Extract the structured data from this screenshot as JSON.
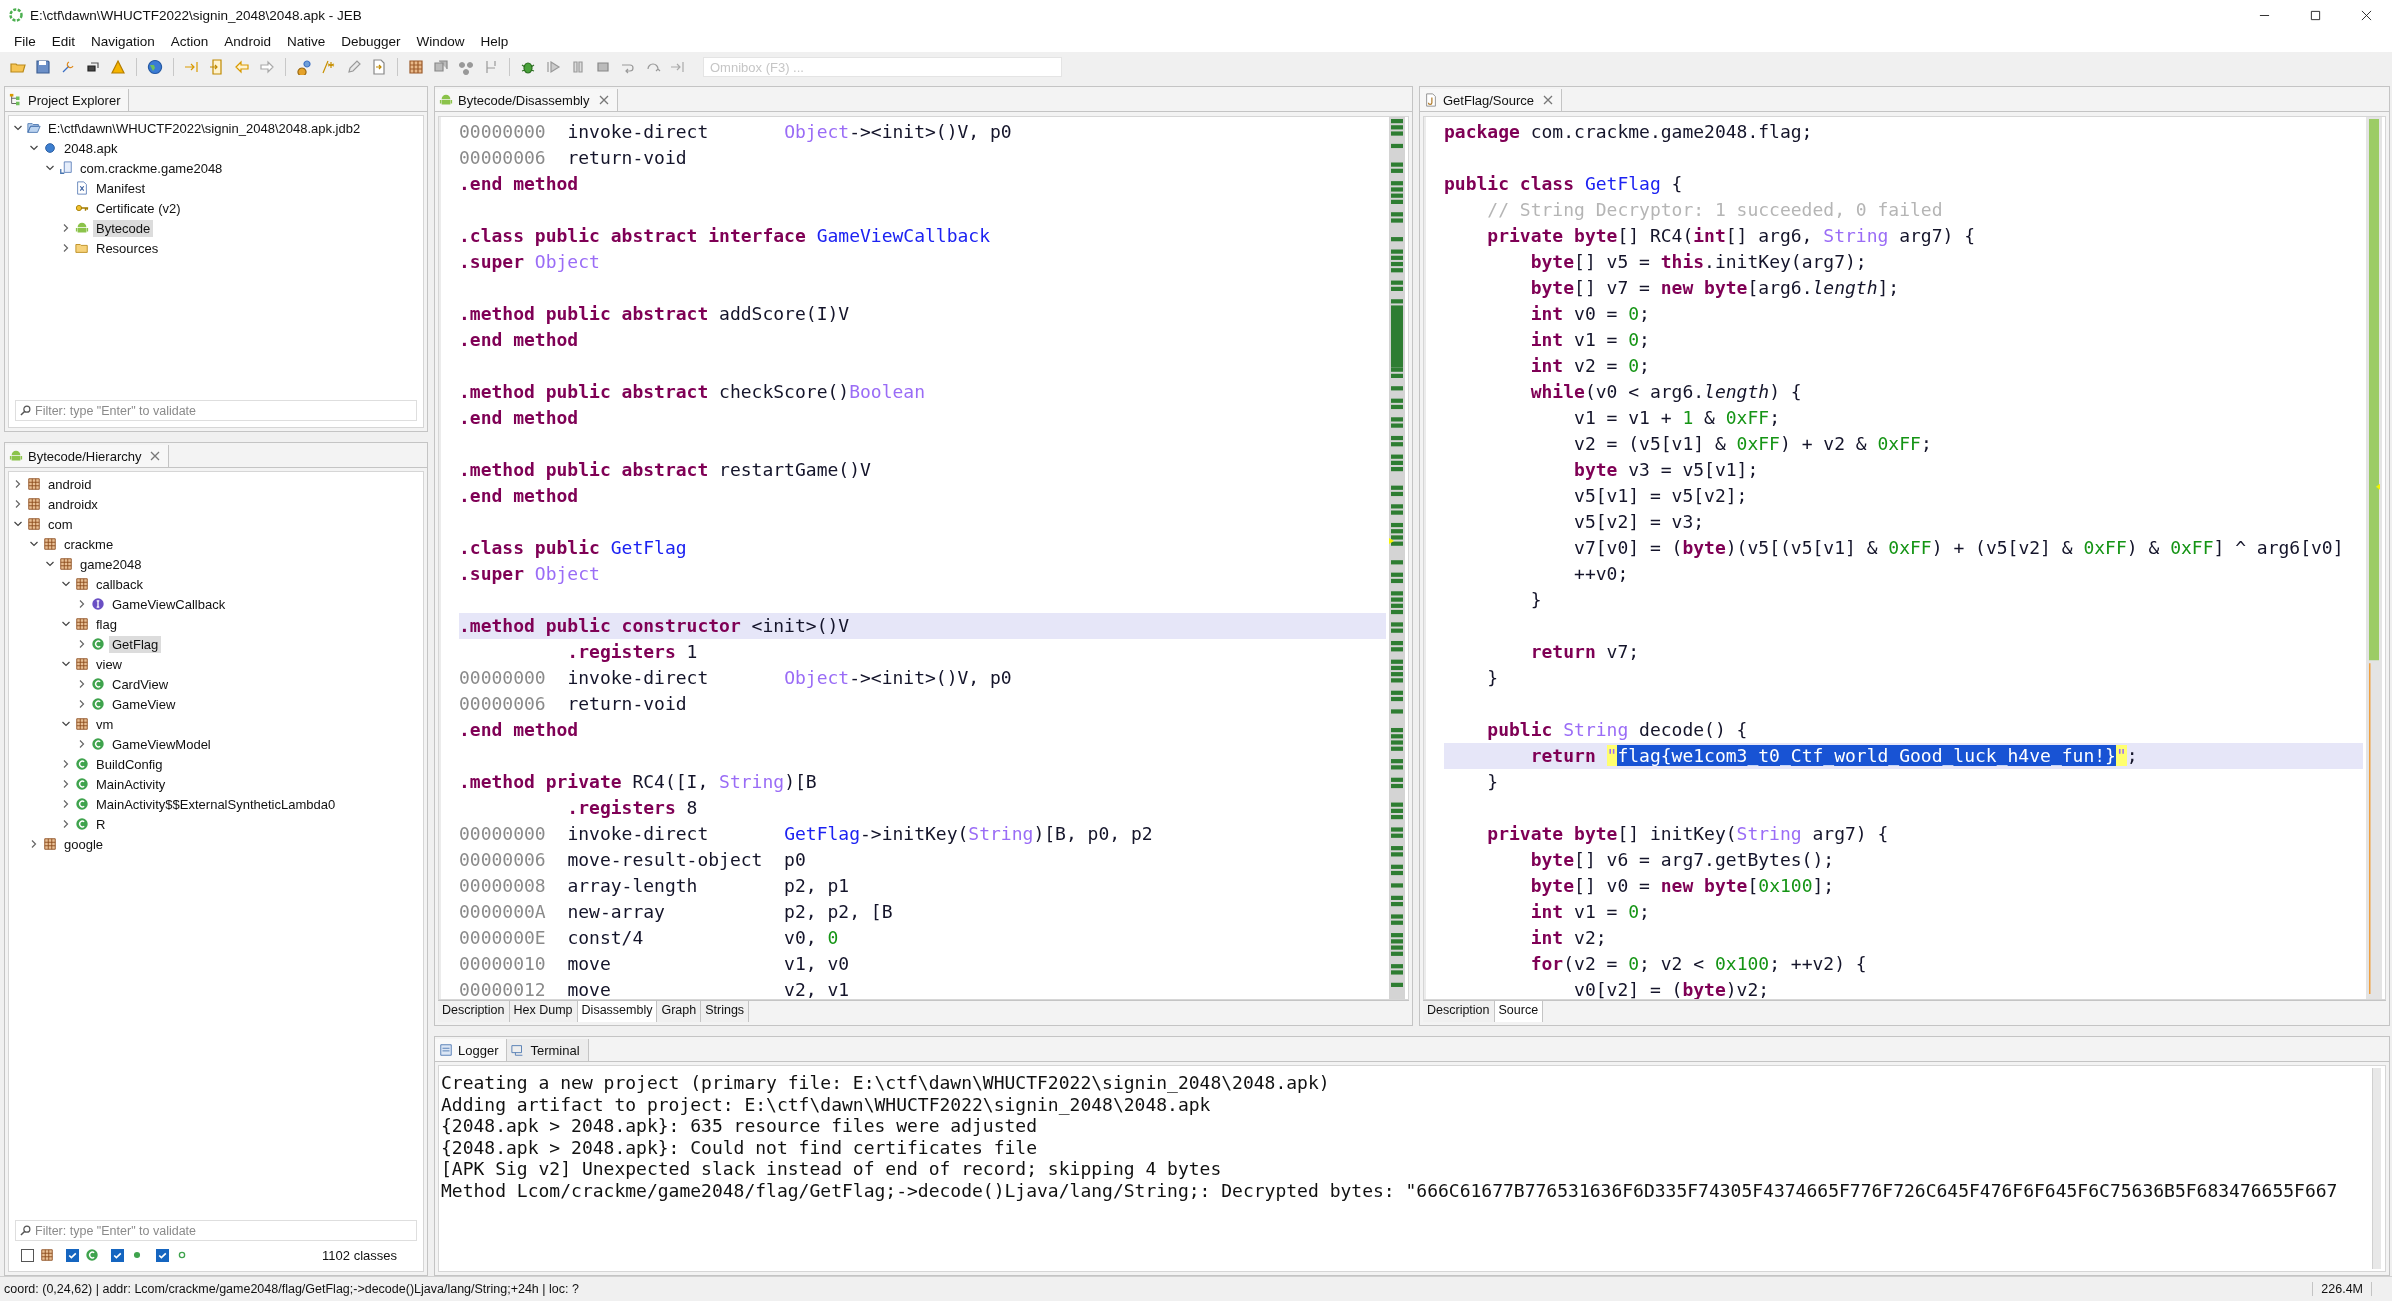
{
  "window": {
    "title": "E:\\ctf\\dawn\\WHUCTF2022\\signin_2048\\2048.apk - JEB"
  },
  "menu": [
    "File",
    "Edit",
    "Navigation",
    "Action",
    "Android",
    "Native",
    "Debugger",
    "Window",
    "Help"
  ],
  "omnibox": {
    "placeholder": "Omnibox (F3) ..."
  },
  "project_explorer": {
    "tab": "Project Explorer",
    "filter_placeholder": "Filter: type \"Enter\" to validate",
    "tree": [
      {
        "label": "E:\\ctf\\dawn\\WHUCTF2022\\signin_2048\\2048.apk.jdb2",
        "kind": "project",
        "expanded": true,
        "selected": false,
        "children": [
          {
            "label": "2048.apk",
            "kind": "apk",
            "expanded": true,
            "selected": false,
            "children": [
              {
                "label": "com.crackme.game2048",
                "kind": "app",
                "expanded": true,
                "selected": false,
                "children": [
                  {
                    "label": "Manifest",
                    "kind": "manifest",
                    "selected": false
                  },
                  {
                    "label": "Certificate (v2)",
                    "kind": "certificate",
                    "selected": false
                  },
                  {
                    "label": "Bytecode",
                    "kind": "android",
                    "expanded": false,
                    "selected": true
                  },
                  {
                    "label": "Resources",
                    "kind": "folder",
                    "expanded": false,
                    "selected": false
                  }
                ]
              }
            ]
          }
        ]
      }
    ]
  },
  "hierarchy": {
    "tab": "Bytecode/Hierarchy",
    "filter_placeholder": "Filter: type \"Enter\" to validate",
    "tree": [
      {
        "label": "android",
        "kind": "package",
        "expanded": false,
        "selected": false
      },
      {
        "label": "androidx",
        "kind": "package",
        "expanded": false,
        "selected": false
      },
      {
        "label": "com",
        "kind": "package",
        "expanded": true,
        "selected": false,
        "children": [
          {
            "label": "crackme",
            "kind": "package",
            "expanded": true,
            "selected": false,
            "children": [
              {
                "label": "game2048",
                "kind": "package",
                "expanded": true,
                "selected": false,
                "children": [
                  {
                    "label": "callback",
                    "kind": "package",
                    "expanded": true,
                    "selected": false,
                    "children": [
                      {
                        "label": "GameViewCallback",
                        "kind": "interface",
                        "expanded": false,
                        "selected": false
                      }
                    ]
                  },
                  {
                    "label": "flag",
                    "kind": "package",
                    "expanded": true,
                    "selected": false,
                    "children": [
                      {
                        "label": "GetFlag",
                        "kind": "class",
                        "expanded": false,
                        "selected": true
                      }
                    ]
                  },
                  {
                    "label": "view",
                    "kind": "package",
                    "expanded": true,
                    "selected": false,
                    "children": [
                      {
                        "label": "CardView",
                        "kind": "class",
                        "expanded": false,
                        "selected": false
                      },
                      {
                        "label": "GameView",
                        "kind": "class",
                        "expanded": false,
                        "selected": false
                      }
                    ]
                  },
                  {
                    "label": "vm",
                    "kind": "package",
                    "expanded": true,
                    "selected": false,
                    "children": [
                      {
                        "label": "GameViewModel",
                        "kind": "class",
                        "expanded": false,
                        "selected": false
                      }
                    ]
                  },
                  {
                    "label": "BuildConfig",
                    "kind": "class",
                    "expanded": false,
                    "selected": false
                  },
                  {
                    "label": "MainActivity",
                    "kind": "class",
                    "expanded": false,
                    "selected": false
                  },
                  {
                    "label": "MainActivity$$ExternalSyntheticLambda0",
                    "kind": "class",
                    "expanded": false,
                    "selected": false
                  },
                  {
                    "label": "R",
                    "kind": "class",
                    "expanded": false,
                    "selected": false
                  }
                ]
              }
            ]
          },
          {
            "label": "google",
            "kind": "package",
            "expanded": false,
            "selected": false
          }
        ]
      }
    ],
    "filters": [
      {
        "kind": "package",
        "checked": false
      },
      {
        "kind": "class",
        "checked": true
      },
      {
        "kind": "method",
        "checked": true
      },
      {
        "kind": "field",
        "checked": true
      }
    ],
    "count": "1102 classes"
  },
  "disassembly": {
    "tab": "Bytecode/Disassembly",
    "bottom_tabs": [
      {
        "label": "Description",
        "selected": false
      },
      {
        "label": "Hex Dump",
        "selected": false
      },
      {
        "label": "Disassembly",
        "selected": true
      },
      {
        "label": "Graph",
        "selected": false
      },
      {
        "label": "Strings",
        "selected": false
      }
    ],
    "lines": [
      {
        "current": false,
        "segments": [
          {
            "kind": "address",
            "text": "00000000"
          },
          {
            "kind": "plain",
            "text": "  invoke-direct       "
          },
          {
            "kind": "type",
            "text": "Object"
          },
          {
            "kind": "plain",
            "text": "-><init>()V, p0"
          }
        ]
      },
      {
        "current": false,
        "segments": [
          {
            "kind": "address",
            "text": "00000006"
          },
          {
            "kind": "plain",
            "text": "  return-void"
          }
        ]
      },
      {
        "current": false,
        "segments": [
          {
            "kind": "keyword",
            "text": ".end method"
          }
        ]
      },
      {
        "current": false
      },
      {
        "current": false,
        "segments": [
          {
            "kind": "keyword",
            "text": ".class public abstract interface "
          },
          {
            "kind": "class",
            "text": "GameViewCallback"
          }
        ]
      },
      {
        "current": false,
        "segments": [
          {
            "kind": "keyword",
            "text": ".super "
          },
          {
            "kind": "type",
            "text": "Object"
          }
        ]
      },
      {
        "current": false
      },
      {
        "current": false,
        "segments": [
          {
            "kind": "keyword",
            "text": ".method public abstract "
          },
          {
            "kind": "plain",
            "text": "addScore(I)V"
          }
        ]
      },
      {
        "current": false,
        "segments": [
          {
            "kind": "keyword",
            "text": ".end method"
          }
        ]
      },
      {
        "current": false
      },
      {
        "current": false,
        "segments": [
          {
            "kind": "keyword",
            "text": ".method public abstract "
          },
          {
            "kind": "plain",
            "text": "checkScore()"
          },
          {
            "kind": "type",
            "text": "Boolean"
          }
        ]
      },
      {
        "current": false,
        "segments": [
          {
            "kind": "keyword",
            "text": ".end method"
          }
        ]
      },
      {
        "current": false
      },
      {
        "current": false,
        "segments": [
          {
            "kind": "keyword",
            "text": ".method public abstract "
          },
          {
            "kind": "plain",
            "text": "restartGame()V"
          }
        ]
      },
      {
        "current": false,
        "segments": [
          {
            "kind": "keyword",
            "text": ".end method"
          }
        ]
      },
      {
        "current": false
      },
      {
        "current": false,
        "segments": [
          {
            "kind": "keyword",
            "text": ".class public "
          },
          {
            "kind": "class",
            "text": "GetFlag"
          }
        ]
      },
      {
        "current": false,
        "segments": [
          {
            "kind": "keyword",
            "text": ".super "
          },
          {
            "kind": "type",
            "text": "Object"
          }
        ]
      },
      {
        "current": false
      },
      {
        "current": true,
        "segments": [
          {
            "kind": "keyword",
            "text": ".method public constructor "
          },
          {
            "kind": "plain",
            "text": "<init>()V"
          }
        ]
      },
      {
        "current": false,
        "segments": [
          {
            "kind": "keyword",
            "text": "          .registers"
          },
          {
            "kind": "plain",
            "text": " 1"
          }
        ]
      },
      {
        "current": false,
        "segments": [
          {
            "kind": "address",
            "text": "00000000"
          },
          {
            "kind": "plain",
            "text": "  invoke-direct       "
          },
          {
            "kind": "type",
            "text": "Object"
          },
          {
            "kind": "plain",
            "text": "-><init>()V, p0"
          }
        ]
      },
      {
        "current": false,
        "segments": [
          {
            "kind": "address",
            "text": "00000006"
          },
          {
            "kind": "plain",
            "text": "  return-void"
          }
        ]
      },
      {
        "current": false,
        "segments": [
          {
            "kind": "keyword",
            "text": ".end method"
          }
        ]
      },
      {
        "current": false
      },
      {
        "current": false,
        "segments": [
          {
            "kind": "keyword",
            "text": ".method private "
          },
          {
            "kind": "plain",
            "text": "RC4([I, "
          },
          {
            "kind": "type",
            "text": "String"
          },
          {
            "kind": "plain",
            "text": ")[B"
          }
        ]
      },
      {
        "current": false,
        "segments": [
          {
            "kind": "keyword",
            "text": "          .registers"
          },
          {
            "kind": "plain",
            "text": " 8"
          }
        ]
      },
      {
        "current": false,
        "segments": [
          {
            "kind": "address",
            "text": "00000000"
          },
          {
            "kind": "plain",
            "text": "  invoke-direct       "
          },
          {
            "kind": "class",
            "text": "GetFlag"
          },
          {
            "kind": "plain",
            "text": "->initKey("
          },
          {
            "kind": "type",
            "text": "String"
          },
          {
            "kind": "plain",
            "text": ")[B, p0, p2"
          }
        ]
      },
      {
        "current": false,
        "segments": [
          {
            "kind": "address",
            "text": "00000006"
          },
          {
            "kind": "plain",
            "text": "  move-result-object  p0"
          }
        ]
      },
      {
        "current": false,
        "segments": [
          {
            "kind": "address",
            "text": "00000008"
          },
          {
            "kind": "plain",
            "text": "  array-length        p2, p1"
          }
        ]
      },
      {
        "current": false,
        "segments": [
          {
            "kind": "address",
            "text": "0000000A"
          },
          {
            "kind": "plain",
            "text": "  new-array           p2, p2, [B"
          }
        ]
      },
      {
        "current": false,
        "segments": [
          {
            "kind": "address",
            "text": "0000000E"
          },
          {
            "kind": "plain",
            "text": "  const/4             v0, "
          },
          {
            "kind": "number",
            "text": "0"
          }
        ]
      },
      {
        "current": false,
        "segments": [
          {
            "kind": "address",
            "text": "00000010"
          },
          {
            "kind": "plain",
            "text": "  move                v1, v0"
          }
        ]
      },
      {
        "current": false,
        "segments": [
          {
            "kind": "address",
            "text": "00000012"
          },
          {
            "kind": "plain",
            "text": "  move                v2, v1"
          }
        ]
      }
    ]
  },
  "source": {
    "tab": "GetFlag/Source",
    "bottom_tabs": [
      {
        "label": "Description",
        "selected": false
      },
      {
        "label": "Source",
        "selected": true
      }
    ],
    "lines": [
      {
        "current": false,
        "segments": [
          {
            "kind": "keyword",
            "text": "package"
          },
          {
            "kind": "plain",
            "text": " com.crackme.game2048.flag;"
          }
        ]
      },
      {
        "current": false
      },
      {
        "current": false,
        "segments": [
          {
            "kind": "keyword",
            "text": "public class "
          },
          {
            "kind": "class",
            "text": "GetFlag"
          },
          {
            "kind": "plain",
            "text": " {"
          }
        ]
      },
      {
        "current": false,
        "segments": [
          {
            "kind": "comment",
            "text": "    // String Decryptor: 1 succeeded, 0 failed"
          }
        ]
      },
      {
        "current": false,
        "segments": [
          {
            "kind": "keyword",
            "text": "    private byte"
          },
          {
            "kind": "plain",
            "text": "[] RC4("
          },
          {
            "kind": "keyword",
            "text": "int"
          },
          {
            "kind": "plain",
            "text": "[] arg6, "
          },
          {
            "kind": "type",
            "text": "String"
          },
          {
            "kind": "plain",
            "text": " arg7) {"
          }
        ]
      },
      {
        "current": false,
        "segments": [
          {
            "kind": "keyword",
            "text": "        byte"
          },
          {
            "kind": "plain",
            "text": "[] v5 = "
          },
          {
            "kind": "keyword",
            "text": "this"
          },
          {
            "kind": "plain",
            "text": ".initKey(arg7);"
          }
        ]
      },
      {
        "current": false,
        "segments": [
          {
            "kind": "keyword",
            "text": "        byte"
          },
          {
            "kind": "plain",
            "text": "[] v7 = "
          },
          {
            "kind": "keyword",
            "text": "new byte"
          },
          {
            "kind": "plain",
            "text": "[arg6."
          },
          {
            "kind": "italic",
            "text": "length"
          },
          {
            "kind": "plain",
            "text": "];"
          }
        ]
      },
      {
        "current": false,
        "segments": [
          {
            "kind": "keyword",
            "text": "        int"
          },
          {
            "kind": "plain",
            "text": " v0 = "
          },
          {
            "kind": "number",
            "text": "0"
          },
          {
            "kind": "plain",
            "text": ";"
          }
        ]
      },
      {
        "current": false,
        "segments": [
          {
            "kind": "keyword",
            "text": "        int"
          },
          {
            "kind": "plain",
            "text": " v1 = "
          },
          {
            "kind": "number",
            "text": "0"
          },
          {
            "kind": "plain",
            "text": ";"
          }
        ]
      },
      {
        "current": false,
        "segments": [
          {
            "kind": "keyword",
            "text": "        int"
          },
          {
            "kind": "plain",
            "text": " v2 = "
          },
          {
            "kind": "number",
            "text": "0"
          },
          {
            "kind": "plain",
            "text": ";"
          }
        ]
      },
      {
        "current": false,
        "segments": [
          {
            "kind": "keyword",
            "text": "        while"
          },
          {
            "kind": "plain",
            "text": "(v0 < arg6."
          },
          {
            "kind": "italic",
            "text": "length"
          },
          {
            "kind": "plain",
            "text": ") {"
          }
        ]
      },
      {
        "current": false,
        "segments": [
          {
            "kind": "plain",
            "text": "            v1 = v1 + "
          },
          {
            "kind": "number",
            "text": "1"
          },
          {
            "kind": "plain",
            "text": " & "
          },
          {
            "kind": "number",
            "text": "0xFF"
          },
          {
            "kind": "plain",
            "text": ";"
          }
        ]
      },
      {
        "current": false,
        "segments": [
          {
            "kind": "plain",
            "text": "            v2 = (v5[v1] & "
          },
          {
            "kind": "number",
            "text": "0xFF"
          },
          {
            "kind": "plain",
            "text": ") + v2 & "
          },
          {
            "kind": "number",
            "text": "0xFF"
          },
          {
            "kind": "plain",
            "text": ";"
          }
        ]
      },
      {
        "current": false,
        "segments": [
          {
            "kind": "keyword",
            "text": "            byte"
          },
          {
            "kind": "plain",
            "text": " v3 = v5[v1];"
          }
        ]
      },
      {
        "current": false,
        "segments": [
          {
            "kind": "plain",
            "text": "            v5[v1] = v5[v2];"
          }
        ]
      },
      {
        "current": false,
        "segments": [
          {
            "kind": "plain",
            "text": "            v5[v2] = v3;"
          }
        ]
      },
      {
        "current": false,
        "segments": [
          {
            "kind": "plain",
            "text": "            v7[v0] = ("
          },
          {
            "kind": "keyword",
            "text": "byte"
          },
          {
            "kind": "plain",
            "text": ")(v5[(v5[v1] & "
          },
          {
            "kind": "number",
            "text": "0xFF"
          },
          {
            "kind": "plain",
            "text": ") + (v5[v2] & "
          },
          {
            "kind": "number",
            "text": "0xFF"
          },
          {
            "kind": "plain",
            "text": ") & "
          },
          {
            "kind": "number",
            "text": "0xFF"
          },
          {
            "kind": "plain",
            "text": "] ^ arg6[v0]"
          }
        ]
      },
      {
        "current": false,
        "segments": [
          {
            "kind": "plain",
            "text": "            ++v0;"
          }
        ]
      },
      {
        "current": false,
        "segments": [
          {
            "kind": "plain",
            "text": "        }"
          }
        ]
      },
      {
        "current": false
      },
      {
        "current": false,
        "segments": [
          {
            "kind": "keyword",
            "text": "        return"
          },
          {
            "kind": "plain",
            "text": " v7;"
          }
        ]
      },
      {
        "current": false,
        "segments": [
          {
            "kind": "plain",
            "text": "    }"
          }
        ]
      },
      {
        "current": false
      },
      {
        "current": false,
        "segments": [
          {
            "kind": "keyword",
            "text": "    public "
          },
          {
            "kind": "type",
            "text": "String"
          },
          {
            "kind": "plain",
            "text": " decode() {"
          }
        ]
      },
      {
        "current": true,
        "segments": [
          {
            "kind": "keyword",
            "text": "        return "
          },
          {
            "kind": "match",
            "text": "\""
          },
          {
            "kind": "selection",
            "text": "flag{we1com3_t0_Ctf_world_Good_luck_h4ve_fun!}"
          },
          {
            "kind": "match",
            "text": "\""
          },
          {
            "kind": "plain",
            "text": ";"
          }
        ]
      },
      {
        "current": false,
        "segments": [
          {
            "kind": "plain",
            "text": "    }"
          }
        ]
      },
      {
        "current": false
      },
      {
        "current": false,
        "segments": [
          {
            "kind": "keyword",
            "text": "    private byte"
          },
          {
            "kind": "plain",
            "text": "[] initKey("
          },
          {
            "kind": "type",
            "text": "String"
          },
          {
            "kind": "plain",
            "text": " arg7) {"
          }
        ]
      },
      {
        "current": false,
        "segments": [
          {
            "kind": "keyword",
            "text": "        byte"
          },
          {
            "kind": "plain",
            "text": "[] v6 = arg7.getBytes();"
          }
        ]
      },
      {
        "current": false,
        "segments": [
          {
            "kind": "keyword",
            "text": "        byte"
          },
          {
            "kind": "plain",
            "text": "[] v0 = "
          },
          {
            "kind": "keyword",
            "text": "new byte"
          },
          {
            "kind": "plain",
            "text": "["
          },
          {
            "kind": "number",
            "text": "0x100"
          },
          {
            "kind": "plain",
            "text": "];"
          }
        ]
      },
      {
        "current": false,
        "segments": [
          {
            "kind": "keyword",
            "text": "        int"
          },
          {
            "kind": "plain",
            "text": " v1 = "
          },
          {
            "kind": "number",
            "text": "0"
          },
          {
            "kind": "plain",
            "text": ";"
          }
        ]
      },
      {
        "current": false,
        "segments": [
          {
            "kind": "keyword",
            "text": "        int"
          },
          {
            "kind": "plain",
            "text": " v2;"
          }
        ]
      },
      {
        "current": false,
        "segments": [
          {
            "kind": "keyword",
            "text": "        for"
          },
          {
            "kind": "plain",
            "text": "(v2 = "
          },
          {
            "kind": "number",
            "text": "0"
          },
          {
            "kind": "plain",
            "text": "; v2 < "
          },
          {
            "kind": "number",
            "text": "0x100"
          },
          {
            "kind": "plain",
            "text": "; ++v2) {"
          }
        ]
      },
      {
        "current": false,
        "segments": [
          {
            "kind": "plain",
            "text": "            v0[v2] = ("
          },
          {
            "kind": "keyword",
            "text": "byte"
          },
          {
            "kind": "plain",
            "text": ")v2;"
          }
        ]
      }
    ]
  },
  "console": {
    "tabs": [
      {
        "label": "Logger",
        "selected": true
      },
      {
        "label": "Terminal",
        "selected": false
      }
    ],
    "lines": [
      "Creating a new project (primary file: E:\\ctf\\dawn\\WHUCTF2022\\signin_2048\\2048.apk)",
      "Adding artifact to project: E:\\ctf\\dawn\\WHUCTF2022\\signin_2048\\2048.apk",
      "{2048.apk > 2048.apk}: 635 resource files were adjusted",
      "{2048.apk > 2048.apk}: Could not find certificates file",
      "[APK Sig v2] Unexpected slack instead of end of record; skipping 4 bytes",
      "Method Lcom/crackme/game2048/flag/GetFlag;->decode()Ljava/lang/String;: Decrypted bytes: \"666C61677B776531636F6D335F74305F4374665F776F726C645F476F6F645F6C75636B5F683476655F667"
    ]
  },
  "status_bar": {
    "text": "coord: (0,24,62) | addr: Lcom/crackme/game2048/flag/GetFlag;->decode()Ljava/lang/String;+24h | loc: ?",
    "memory": "226.4M"
  }
}
